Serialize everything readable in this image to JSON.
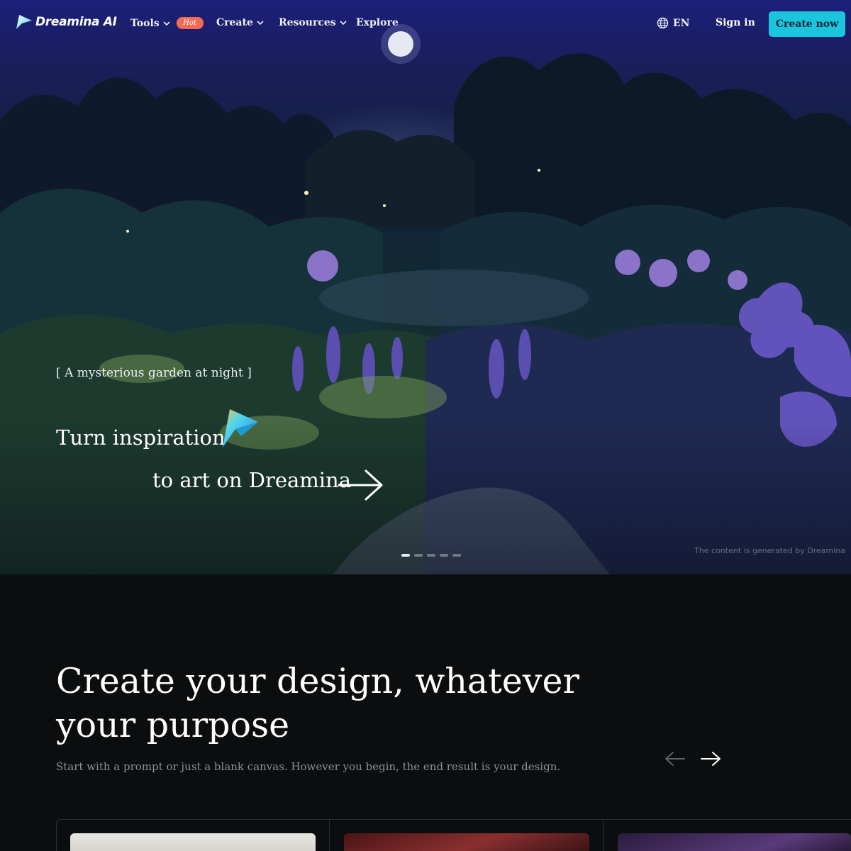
{
  "nav": {
    "logo_text": "Dreamina AI",
    "items": [
      {
        "label": "Tools",
        "badge": "Hot"
      },
      {
        "label": "Create"
      },
      {
        "label": "Resources"
      },
      {
        "label": "Explore"
      }
    ],
    "language": "EN",
    "sign_in": "Sign in",
    "create_now": "Create now"
  },
  "hero": {
    "prompt": "[ A mysterious garden at night ]",
    "headline_line1": "Turn inspiration",
    "headline_line2": "to art on Dreamina",
    "slide_count": 5,
    "active_slide": 1,
    "credit": "The content is generated by Dreamina"
  },
  "design_section": {
    "title": "Create your design, whatever your purpose",
    "subtitle": "Start with a prompt or just a blank canvas. However you begin, the end result is your design."
  },
  "colors": {
    "accent": "#1bc5dd",
    "hot_badge": "#f46a55",
    "page_bg": "#0b0d0e"
  },
  "icons": [
    "dreamina-logo-icon",
    "chevron-down-icon",
    "globe-icon",
    "arrow-right-icon",
    "arrow-left-icon"
  ]
}
